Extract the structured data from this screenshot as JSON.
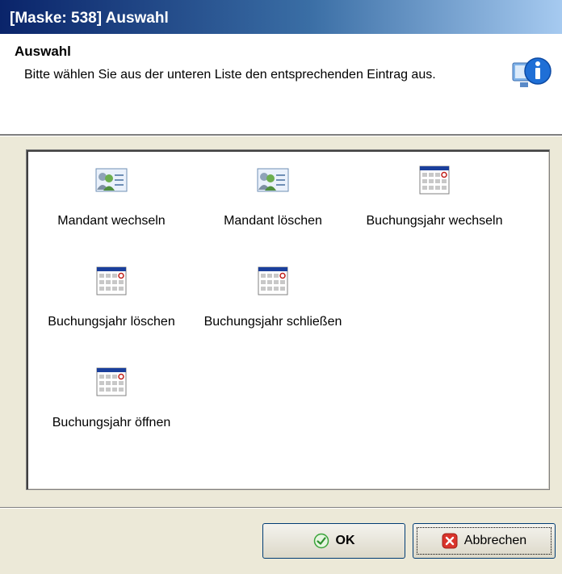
{
  "window": {
    "title": "[Maske: 538] Auswahl"
  },
  "header": {
    "title": "Auswahl",
    "text": "Bitte wählen Sie aus der unteren Liste den entsprechenden Eintrag aus.",
    "icon": "info-icon"
  },
  "items": [
    {
      "label": "Mandant wechseln",
      "icon": "users-card-icon"
    },
    {
      "label": "Mandant löschen",
      "icon": "users-card-icon"
    },
    {
      "label": "Buchungsjahr wechseln",
      "icon": "calendar-icon"
    },
    {
      "label": "Buchungsjahr löschen",
      "icon": "calendar-icon"
    },
    {
      "label": "Buchungsjahr schließen",
      "icon": "calendar-icon"
    },
    {
      "label": "Buchungsjahr öffnen",
      "icon": "calendar-icon"
    }
  ],
  "buttons": {
    "ok_label": "OK",
    "cancel_label": "Abbrechen"
  },
  "colors": {
    "titlebar": "#0a246a",
    "ok_icon": "#3aa43a",
    "cancel_icon": "#d9342b"
  }
}
